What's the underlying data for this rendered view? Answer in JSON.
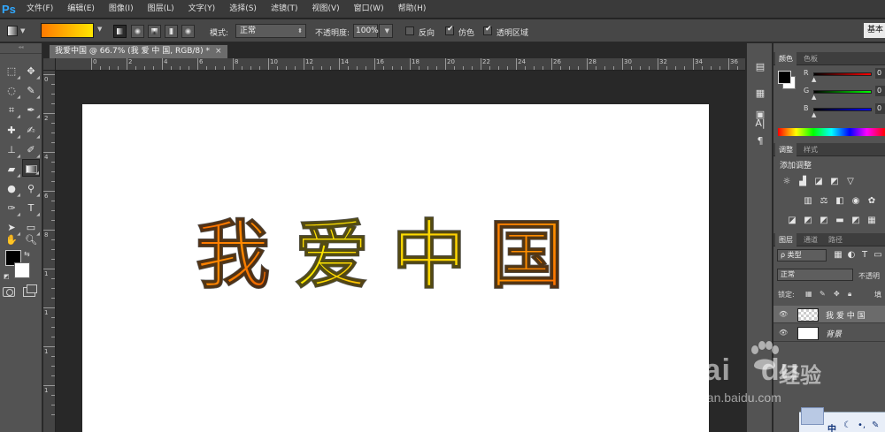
{
  "app": {
    "logo": "Ps"
  },
  "menu": [
    "文件(F)",
    "编辑(E)",
    "图像(I)",
    "图层(L)",
    "文字(Y)",
    "选择(S)",
    "滤镜(T)",
    "视图(V)",
    "窗口(W)",
    "帮助(H)"
  ],
  "options": {
    "mode_label": "模式:",
    "mode_value": "正常",
    "opacity_label": "不透明度:",
    "opacity_value": "100%",
    "reverse_label": "反向",
    "dither_label": "仿色",
    "transparency_label": "透明区域",
    "reverse_checked": false,
    "dither_checked": true,
    "transparency_checked": true,
    "workspace": "基本",
    "gradient_colors": [
      "#ff7a00",
      "#ffb000",
      "#ffe600"
    ]
  },
  "document": {
    "tab_title": "我爱中国 @ 66.7% (我 爱 中 国, RGB/8) *",
    "tab_close": "×",
    "ruler_h": [
      "0",
      "2",
      "4",
      "6",
      "8",
      "10",
      "12",
      "14",
      "16",
      "18",
      "20",
      "22",
      "24",
      "26",
      "28",
      "30",
      "32",
      "34",
      "36"
    ],
    "ruler_v": [
      "0",
      "2",
      "4",
      "6",
      "8",
      "1",
      "1",
      "1",
      "1"
    ],
    "text_glyphs": [
      {
        "char": "我",
        "gradient": [
          "#ff6a00",
          "#ff8a00",
          "#e65a00"
        ]
      },
      {
        "char": "爱",
        "gradient": [
          "#ffd400",
          "#ffe800",
          "#ffb000"
        ]
      },
      {
        "char": "中",
        "gradient": [
          "#ffe800",
          "#ffd000",
          "#ffe800"
        ]
      },
      {
        "char": "国",
        "gradient": [
          "#ff7a00",
          "#ff9000",
          "#ff6a00"
        ]
      }
    ]
  },
  "panels": {
    "color_tabs": [
      "颜色",
      "色板"
    ],
    "sliders": [
      {
        "label": "R",
        "value": "0",
        "track": "linear-gradient(90deg,#000,#f00)"
      },
      {
        "label": "G",
        "value": "0",
        "track": "linear-gradient(90deg,#000,#0f0)"
      },
      {
        "label": "B",
        "value": "0",
        "track": "linear-gradient(90deg,#000,#00f)"
      }
    ],
    "adjust_tabs": [
      "调整",
      "样式"
    ],
    "adjust_title": "添加调整",
    "layer_tabs": [
      "图层",
      "通道",
      "路径"
    ],
    "kind_filter": "ρ 类型",
    "blend_mode": "正常",
    "opacity_short": "不透明",
    "lock_label": "锁定:",
    "fill_short": "填",
    "layers": [
      {
        "name": "我 爱 中 国",
        "selected": true,
        "transparent": true,
        "italic": false
      },
      {
        "name": "背景",
        "selected": false,
        "transparent": false,
        "italic": true
      }
    ]
  },
  "watermark": {
    "brand": "Bai",
    "brand2": "du",
    "cn": "经验",
    "url": "jingyan.baidu.com"
  },
  "ime": {
    "lang": "中",
    "moon": "☾",
    "dot": "•,",
    "tool": "✎"
  }
}
